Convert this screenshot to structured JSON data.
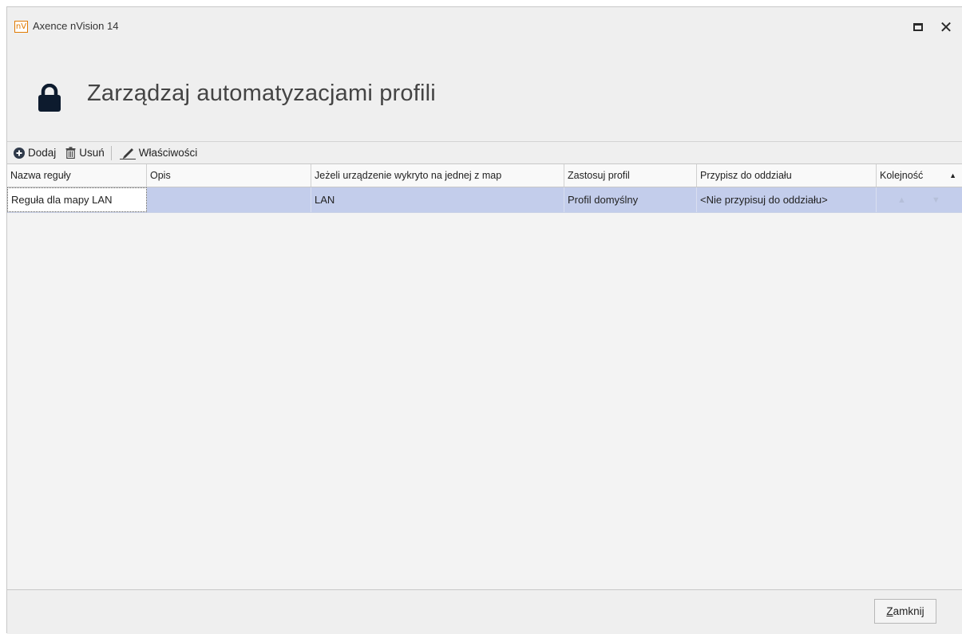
{
  "window": {
    "title": "Axence nVision 14",
    "app_icon_text": "nV"
  },
  "header": {
    "title": "Zarządzaj automatyzacjami profili",
    "icon": "lock-icon"
  },
  "toolbar": {
    "add_label": "Dodaj",
    "delete_label": "Usuń",
    "properties_label": "Właściwości"
  },
  "grid": {
    "columns": [
      "Nazwa reguły",
      "Opis",
      "Jeżeli urządzenie wykryto na jednej z map",
      "Zastosuj profil",
      "Przypisz do oddziału",
      "Kolejność"
    ],
    "sort_indicator": "▲",
    "rows": [
      {
        "name": "Reguła dla mapy LAN",
        "description": "",
        "map": "LAN",
        "profile": "Profil domyślny",
        "branch": "<Nie przypisuj do oddziału>",
        "order_up": "▲",
        "order_down": "▼"
      }
    ]
  },
  "footer": {
    "close_first_letter": "Z",
    "close_rest": "amknij"
  },
  "colors": {
    "selection": "#c3cdeb",
    "window_bg": "#efefef",
    "add_icon": "#2f3a4a"
  }
}
